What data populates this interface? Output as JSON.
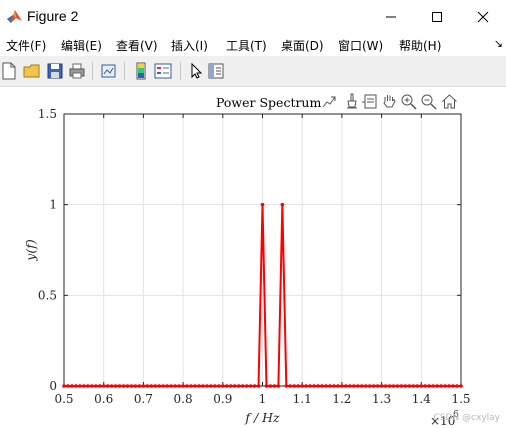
{
  "window": {
    "title": "Figure 2",
    "buttons": [
      "minimize",
      "maximize",
      "close"
    ]
  },
  "menu": [
    {
      "label": "文件(F)"
    },
    {
      "label": "编辑(E)"
    },
    {
      "label": "查看(V)"
    },
    {
      "label": "插入(I)"
    },
    {
      "label": "工具(T)"
    },
    {
      "label": "桌面(D)"
    },
    {
      "label": "窗口(W)"
    },
    {
      "label": "帮助(H)"
    }
  ],
  "menu_overflow": "↘",
  "toolbar": {
    "icons": [
      "new-figure-icon",
      "open-file-icon",
      "save-icon",
      "print-icon",
      "link-plot-icon",
      "colorbar-icon",
      "legend-icon",
      "pointer-icon",
      "property-inspector-icon"
    ]
  },
  "axes_toolbar": {
    "icons": [
      "export-icon",
      "brush-icon",
      "data-tips-icon",
      "pan-hand-icon",
      "zoom-in-icon",
      "zoom-out-icon",
      "home-icon"
    ]
  },
  "watermark": "CSDN @cxylay",
  "chart_data": {
    "type": "line",
    "title": "Power Spectrum",
    "xlabel": "f / Hz",
    "ylabel": "y(f)",
    "xlim": [
      500000,
      1500000
    ],
    "ylim": [
      0,
      1.5
    ],
    "x_exponent_label": "×10",
    "x_exponent": "6",
    "xticks": [
      500000,
      600000,
      700000,
      800000,
      900000,
      1000000,
      1100000,
      1200000,
      1300000,
      1400000,
      1500000
    ],
    "xtick_labels": [
      "0.5",
      "0.6",
      "0.7",
      "0.8",
      "0.9",
      "1",
      "1.1",
      "1.2",
      "1.3",
      "1.4",
      "1.5"
    ],
    "yticks": [
      0,
      0.5,
      1,
      1.5
    ],
    "ytick_labels": [
      "0",
      "0.5",
      "1",
      "1.5"
    ],
    "grid": true,
    "line_color": "#ff0000",
    "marker": "dot",
    "series": [
      {
        "x": [
          500000,
          510000,
          520000,
          530000,
          540000,
          550000,
          560000,
          570000,
          580000,
          590000,
          600000,
          610000,
          620000,
          630000,
          640000,
          650000,
          660000,
          670000,
          680000,
          690000,
          700000,
          710000,
          720000,
          730000,
          740000,
          750000,
          760000,
          770000,
          780000,
          790000,
          800000,
          810000,
          820000,
          830000,
          840000,
          850000,
          860000,
          870000,
          880000,
          890000,
          900000,
          910000,
          920000,
          930000,
          940000,
          950000,
          960000,
          970000,
          980000,
          990000,
          1000000,
          1010000,
          1020000,
          1030000,
          1040000,
          1050000,
          1060000,
          1070000,
          1080000,
          1090000,
          1100000,
          1110000,
          1120000,
          1130000,
          1140000,
          1150000,
          1160000,
          1170000,
          1180000,
          1190000,
          1200000,
          1210000,
          1220000,
          1230000,
          1240000,
          1250000,
          1260000,
          1270000,
          1280000,
          1290000,
          1300000,
          1310000,
          1320000,
          1330000,
          1340000,
          1350000,
          1360000,
          1370000,
          1380000,
          1390000,
          1400000,
          1410000,
          1420000,
          1430000,
          1440000,
          1450000,
          1460000,
          1470000,
          1480000,
          1490000,
          1500000
        ],
        "y": [
          0,
          0,
          0,
          0,
          0,
          0,
          0,
          0,
          0,
          0,
          0,
          0,
          0,
          0,
          0,
          0,
          0,
          0,
          0,
          0,
          0,
          0,
          0,
          0,
          0,
          0,
          0,
          0,
          0,
          0,
          0,
          0,
          0,
          0,
          0,
          0,
          0,
          0,
          0,
          0,
          0,
          0,
          0,
          0,
          0,
          0,
          0,
          0,
          0,
          0,
          1,
          0,
          0,
          0,
          0,
          1,
          0,
          0,
          0,
          0,
          0,
          0,
          0,
          0,
          0,
          0,
          0,
          0,
          0,
          0,
          0,
          0,
          0,
          0,
          0,
          0,
          0,
          0,
          0,
          0,
          0,
          0,
          0,
          0,
          0,
          0,
          0,
          0,
          0,
          0,
          0,
          0,
          0,
          0,
          0,
          0,
          0,
          0,
          0,
          0,
          0
        ]
      }
    ]
  }
}
